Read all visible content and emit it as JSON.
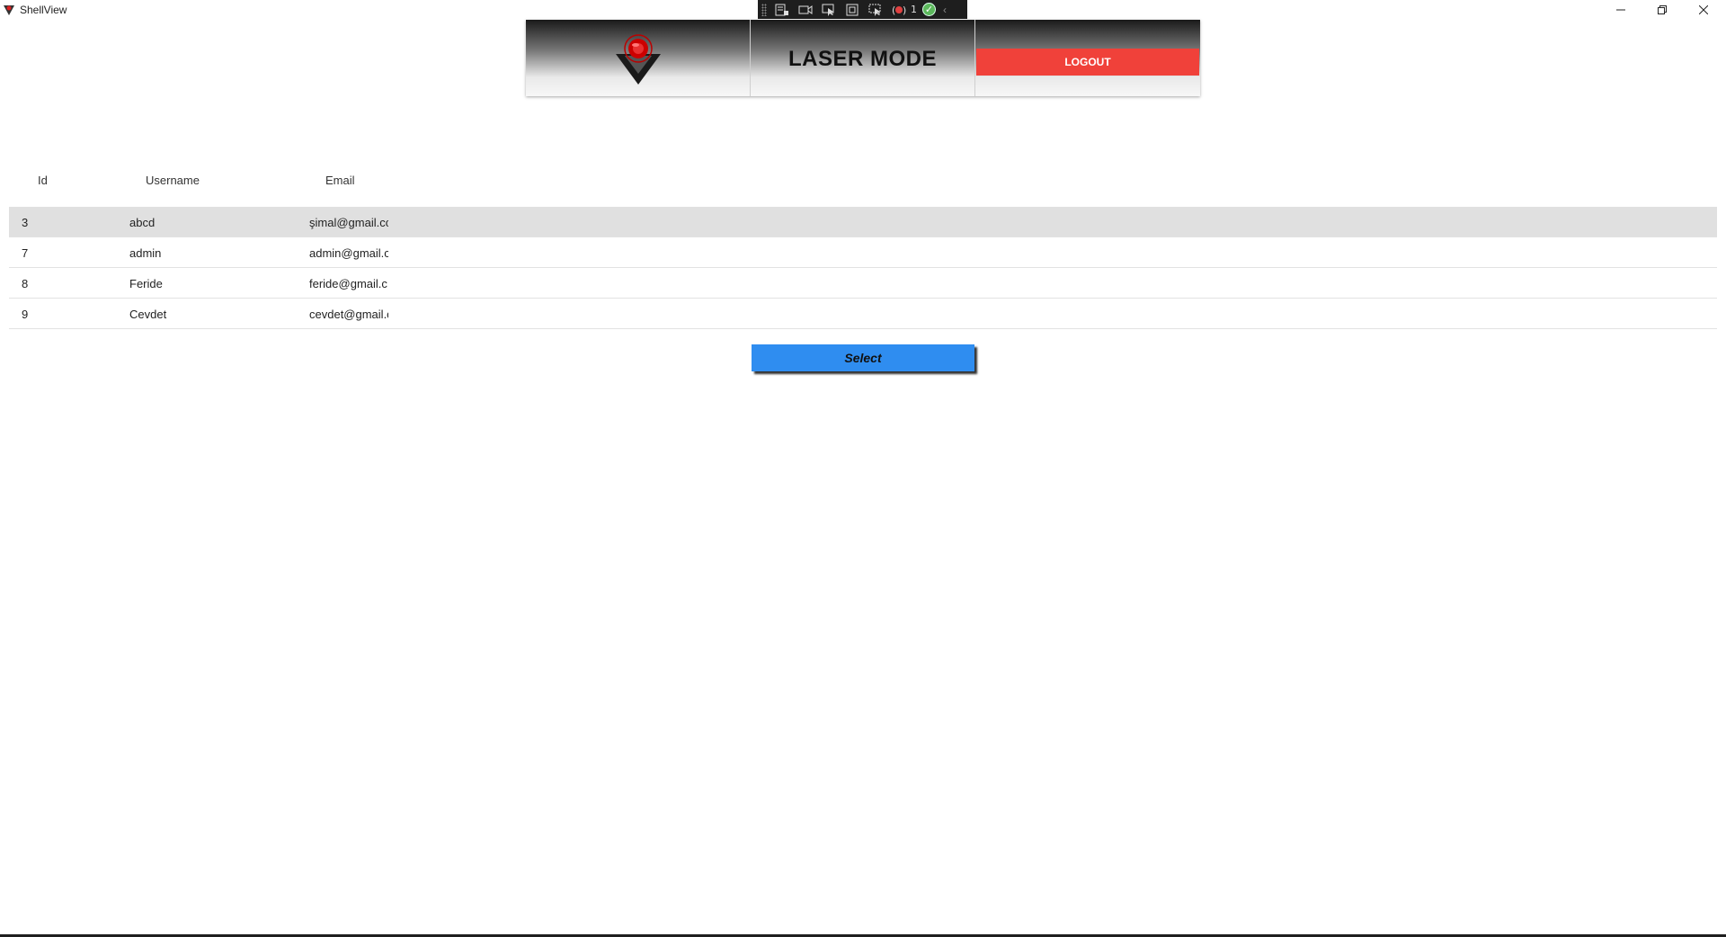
{
  "window": {
    "title": "ShellView",
    "app_icon": "laser-logo-icon",
    "controls": {
      "minimize": "minimize-icon",
      "maximize": "restore-icon",
      "close": "close-icon"
    }
  },
  "debug_toolbar": {
    "icons": [
      "live-visual-tree-icon",
      "record-icon",
      "select-element-icon",
      "display-layout-adorners-icon",
      "track-focus-icon",
      "binding-failures-icon"
    ],
    "binding_failures_count": "1",
    "status_icon": "check-circle-icon"
  },
  "header": {
    "logo_icon": "laser-target-logo-icon",
    "title": "LASER MODE",
    "logout_label": "LOGOUT",
    "colors": {
      "logout": "#f0413a"
    }
  },
  "grid": {
    "columns": [
      "Id",
      "Username",
      "Email"
    ],
    "rows": [
      {
        "id": "3",
        "username": "abcd",
        "email": "şimal@gmail.cc",
        "selected": true
      },
      {
        "id": "7",
        "username": "admin",
        "email": "admin@gmail.c",
        "selected": false
      },
      {
        "id": "8",
        "username": "Feride",
        "email": "feride@gmail.c",
        "selected": false
      },
      {
        "id": "9",
        "username": "Cevdet",
        "email": "cevdet@gmail.c",
        "selected": false
      }
    ]
  },
  "select_button": {
    "label": "Select",
    "color": "#2f8df0"
  }
}
